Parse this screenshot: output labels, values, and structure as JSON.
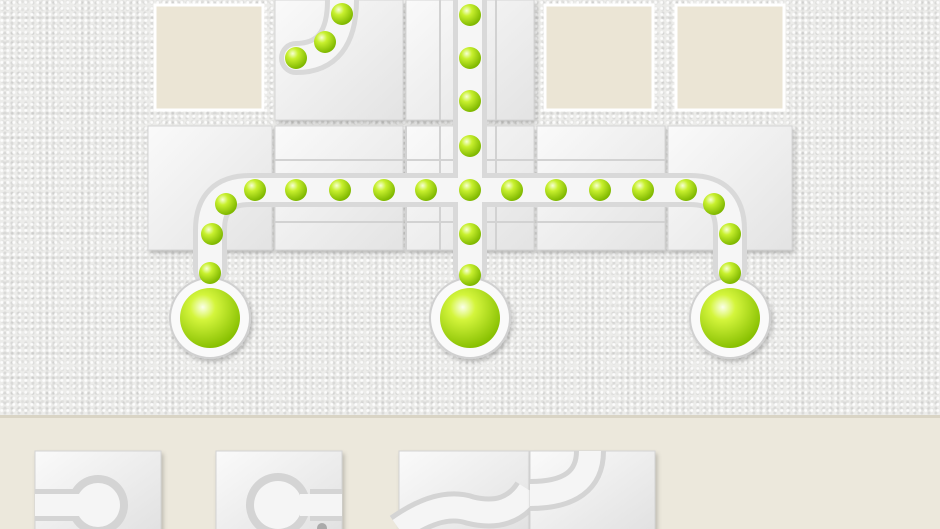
{
  "game": {
    "board": {
      "empty_slots": 3,
      "pipe_tiles": 14,
      "outlets": 3,
      "flow_color": "#b8ec1c",
      "tile_color": "#f2f2f2",
      "slot_color": "#ebe5d5"
    },
    "tray": {
      "background": "#ece8dc",
      "pieces": [
        {
          "icon": "pipe-cap-icon"
        },
        {
          "icon": "pipe-bulb-icon"
        },
        {
          "icon": "pipe-s-curve-icon"
        },
        {
          "icon": "pipe-curve-icon"
        }
      ]
    }
  }
}
